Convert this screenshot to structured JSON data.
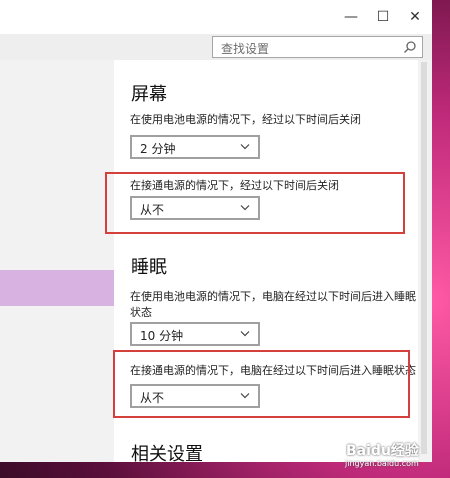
{
  "window_controls": {
    "minimize": "—",
    "maximize": "☐",
    "close": "✕"
  },
  "search": {
    "placeholder": "查找设置"
  },
  "screen_section": {
    "title": "屏幕",
    "battery_label": "在使用电池电源的情况下，经过以下时间后关闭",
    "battery_value": "2 分钟",
    "plugged_label": "在接通电源的情况下，经过以下时间后关闭",
    "plugged_value": "从不"
  },
  "sleep_section": {
    "title": "睡眠",
    "battery_label": "在使用电池电源的情况下，电脑在经过以下时间后进入睡眠状态",
    "battery_value": "10 分钟",
    "plugged_label": "在接通电源的情况下，电脑在经过以下时间后进入睡眠状态",
    "plugged_value": "从不"
  },
  "related_section": {
    "title": "相关设置"
  },
  "watermark": {
    "brand": "Baidu经验",
    "url": "jingyan.baidu.com"
  },
  "colors": {
    "annotation_red": "#d4403b",
    "left_highlight": "#d8b2e0"
  }
}
